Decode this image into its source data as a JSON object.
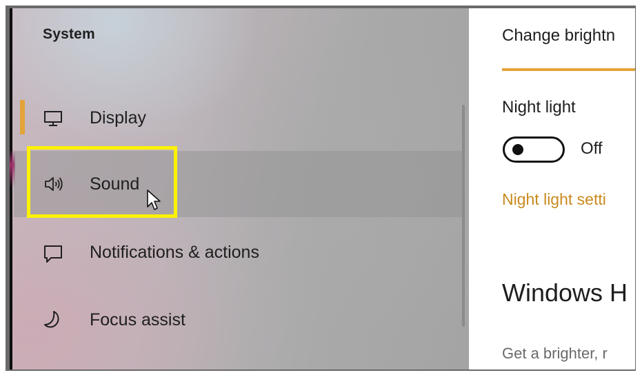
{
  "sidebar": {
    "title": "System",
    "items": [
      {
        "label": "Display",
        "icon": "display-icon",
        "selected": true
      },
      {
        "label": "Sound",
        "icon": "speaker-icon",
        "hovered": true
      },
      {
        "label": "Notifications & actions",
        "icon": "message-icon"
      },
      {
        "label": "Focus assist",
        "icon": "moon-icon"
      }
    ]
  },
  "content": {
    "brightness_label": "Change brightn",
    "night_light": {
      "label": "Night light",
      "toggle_state": "Off",
      "settings_link": "Night light setti"
    },
    "section_heading": "Windows H",
    "section_text": "Get a brighter, r"
  },
  "colors": {
    "accent": "#e3a33a",
    "link": "#c98a1e",
    "highlight_box": "#fff200"
  }
}
